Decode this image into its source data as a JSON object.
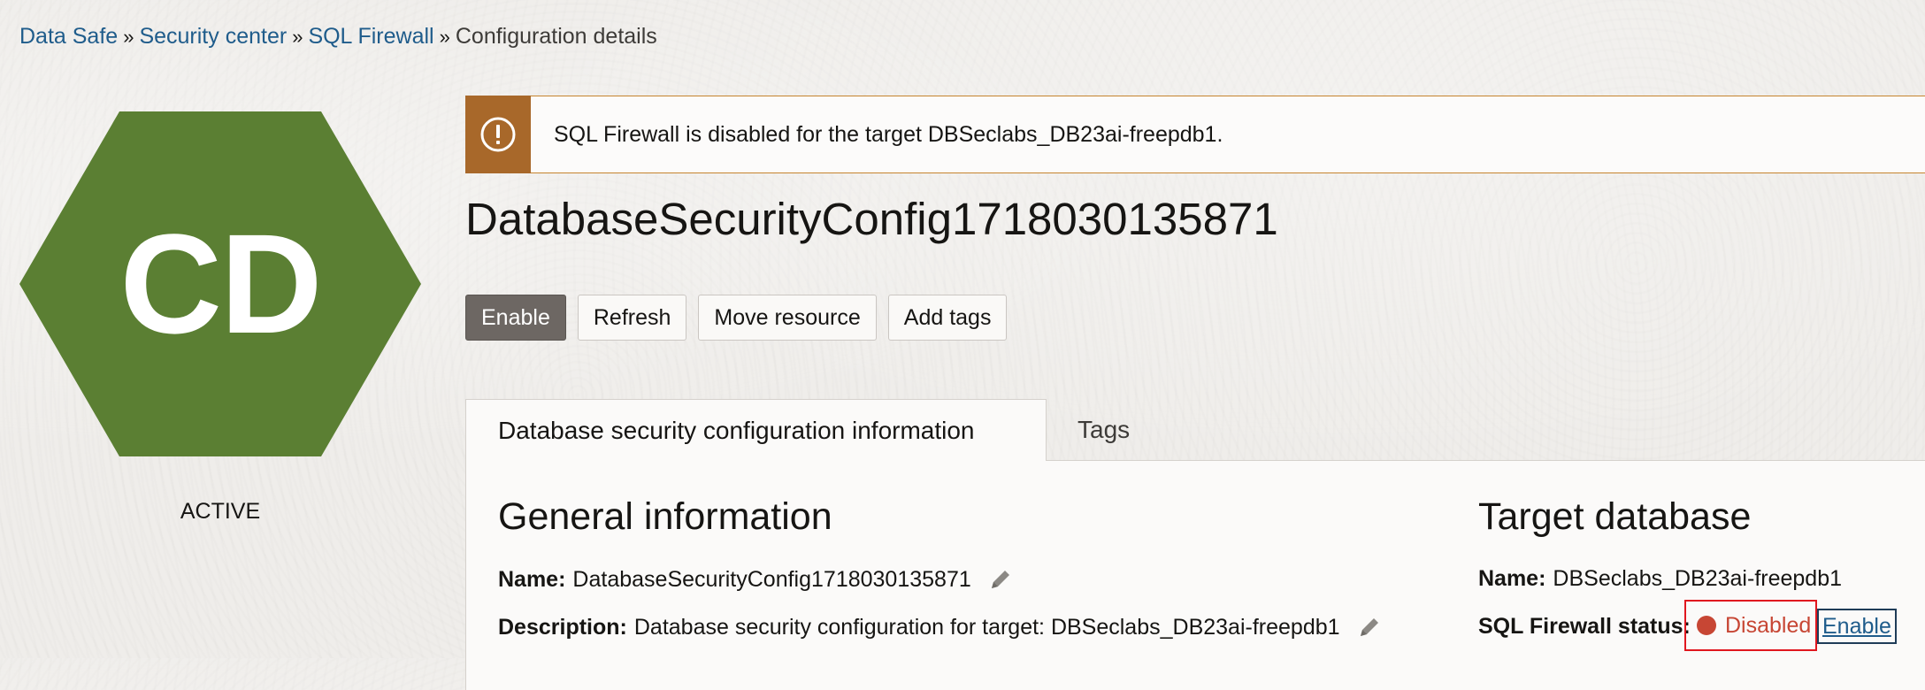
{
  "breadcrumb": {
    "items": [
      "Data Safe",
      "Security center",
      "SQL Firewall"
    ],
    "current": "Configuration details",
    "separator": "»"
  },
  "avatar": {
    "initials": "CD",
    "color": "#5b7f33",
    "lifecycle_state": "ACTIVE"
  },
  "alert": {
    "icon": "exclamation-circle-icon",
    "color": "#a8682a",
    "message": "SQL Firewall is disabled for the target DBSeclabs_DB23ai-freepdb1."
  },
  "page_title": "DatabaseSecurityConfig1718030135871",
  "actions": {
    "enable_label": "Enable",
    "refresh_label": "Refresh",
    "move_label": "Move resource",
    "tags_label": "Add tags"
  },
  "tabs": [
    {
      "label": "Database security configuration information",
      "active": true
    },
    {
      "label": "Tags",
      "active": false
    }
  ],
  "general": {
    "title": "General information",
    "name_label": "Name:",
    "name_value": "DatabaseSecurityConfig1718030135871",
    "description_label": "Description:",
    "description_value": "Database security configuration for target: DBSeclabs_DB23ai-freepdb1",
    "edit_icon": "pencil-icon"
  },
  "target": {
    "title": "Target database",
    "name_label": "Name:",
    "name_value": "DBSeclabs_DB23ai-freepdb1",
    "status_label": "SQL Firewall status:",
    "status_value": "Disabled",
    "status_color": "#c74634",
    "enable_link": "Enable"
  }
}
